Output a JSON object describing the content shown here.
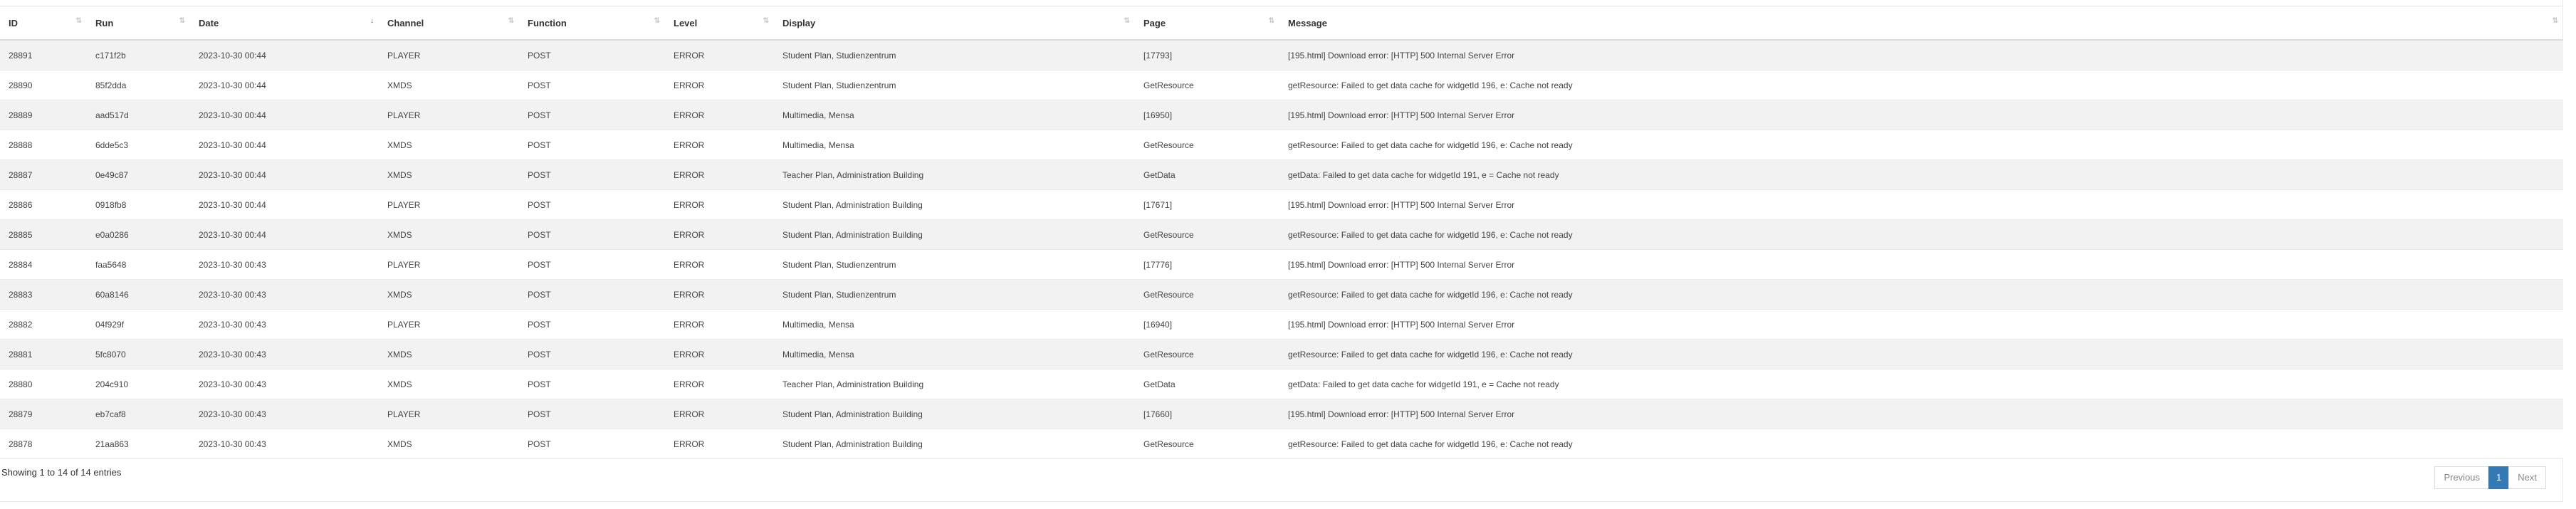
{
  "table": {
    "headers": [
      "ID",
      "Run",
      "Date",
      "Channel",
      "Function",
      "Level",
      "Display",
      "Page",
      "Message"
    ],
    "rows": [
      [
        "28891",
        "c171f2b",
        "2023-10-30 00:44",
        "PLAYER",
        "POST",
        "ERROR",
        "Student Plan, Studienzentrum",
        "[17793]",
        "[195.html] Download error: [HTTP] 500 Internal Server Error"
      ],
      [
        "28890",
        "85f2dda",
        "2023-10-30 00:44",
        "XMDS",
        "POST",
        "ERROR",
        "Student Plan, Studienzentrum",
        "GetResource",
        "getResource: Failed to get data cache for widgetId 196, e: Cache not ready"
      ],
      [
        "28889",
        "aad517d",
        "2023-10-30 00:44",
        "PLAYER",
        "POST",
        "ERROR",
        "Multimedia, Mensa",
        "[16950]",
        "[195.html] Download error: [HTTP] 500 Internal Server Error"
      ],
      [
        "28888",
        "6dde5c3",
        "2023-10-30 00:44",
        "XMDS",
        "POST",
        "ERROR",
        "Multimedia, Mensa",
        "GetResource",
        "getResource: Failed to get data cache for widgetId 196, e: Cache not ready"
      ],
      [
        "28887",
        "0e49c87",
        "2023-10-30 00:44",
        "XMDS",
        "POST",
        "ERROR",
        "Teacher Plan, Administration Building",
        "GetData",
        "getData: Failed to get data cache for widgetId 191, e = Cache not ready"
      ],
      [
        "28886",
        "0918fb8",
        "2023-10-30 00:44",
        "PLAYER",
        "POST",
        "ERROR",
        "Student Plan, Administration Building",
        "[17671]",
        "[195.html] Download error: [HTTP] 500 Internal Server Error"
      ],
      [
        "28885",
        "e0a0286",
        "2023-10-30 00:44",
        "XMDS",
        "POST",
        "ERROR",
        "Student Plan, Administration Building",
        "GetResource",
        "getResource: Failed to get data cache for widgetId 196, e: Cache not ready"
      ],
      [
        "28884",
        "faa5648",
        "2023-10-30 00:43",
        "PLAYER",
        "POST",
        "ERROR",
        "Student Plan, Studienzentrum",
        "[17776]",
        "[195.html] Download error: [HTTP] 500 Internal Server Error"
      ],
      [
        "28883",
        "60a8146",
        "2023-10-30 00:43",
        "XMDS",
        "POST",
        "ERROR",
        "Student Plan, Studienzentrum",
        "GetResource",
        "getResource: Failed to get data cache for widgetId 196, e: Cache not ready"
      ],
      [
        "28882",
        "04f929f",
        "2023-10-30 00:43",
        "PLAYER",
        "POST",
        "ERROR",
        "Multimedia, Mensa",
        "[16940]",
        "[195.html] Download error: [HTTP] 500 Internal Server Error"
      ],
      [
        "28881",
        "5fc8070",
        "2023-10-30 00:43",
        "XMDS",
        "POST",
        "ERROR",
        "Multimedia, Mensa",
        "GetResource",
        "getResource: Failed to get data cache for widgetId 196, e: Cache not ready"
      ],
      [
        "28880",
        "204c910",
        "2023-10-30 00:43",
        "XMDS",
        "POST",
        "ERROR",
        "Teacher Plan, Administration Building",
        "GetData",
        "getData: Failed to get data cache for widgetId 191, e = Cache not ready"
      ],
      [
        "28879",
        "eb7caf8",
        "2023-10-30 00:43",
        "PLAYER",
        "POST",
        "ERROR",
        "Student Plan, Administration Building",
        "[17660]",
        "[195.html] Download error: [HTTP] 500 Internal Server Error"
      ],
      [
        "28878",
        "21aa863",
        "2023-10-30 00:43",
        "XMDS",
        "POST",
        "ERROR",
        "Student Plan, Administration Building",
        "GetResource",
        "getResource: Failed to get data cache for widgetId 196, e: Cache not ready"
      ]
    ]
  },
  "footer": {
    "info": "Showing 1 to 14 of 14 entries",
    "previous": "Previous",
    "current_page": "1",
    "next": "Next"
  },
  "icons": {
    "sort_default": "sort-both-icon",
    "sort_active": "sort-desc-icon"
  },
  "colors": {
    "accent": "#337ab7",
    "stripe": "#f2f2f2"
  }
}
